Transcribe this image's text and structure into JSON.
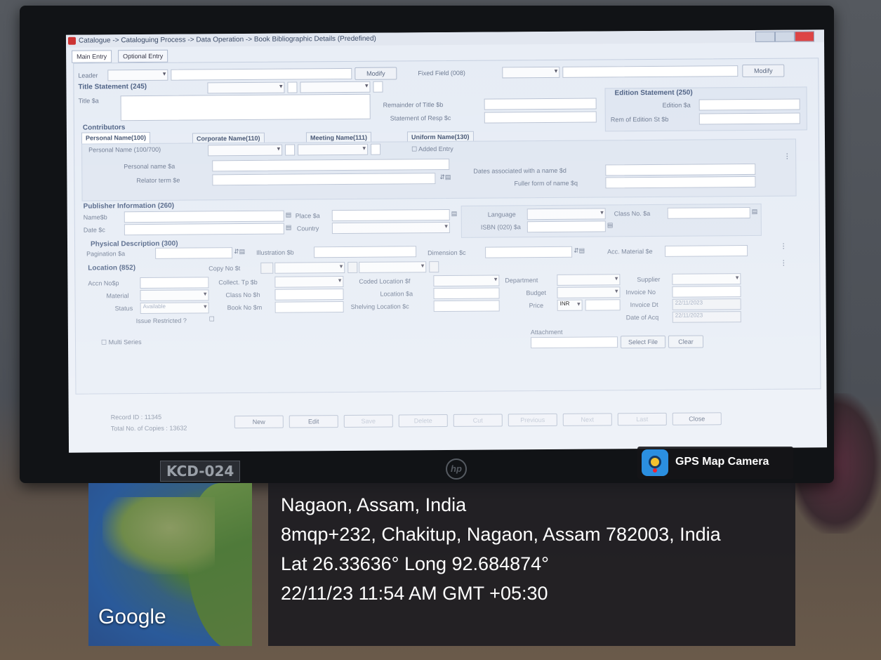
{
  "window": {
    "breadcrumb": "Catalogue -> Cataloguing Process -> Data Operation -> Book Bibliographic Details (Predefined)",
    "tabs": [
      "Main Entry",
      "Optional Entry"
    ]
  },
  "form": {
    "leader_label": "Leader",
    "modify_label": "Modify",
    "fixed_field_label": "Fixed Field (008)",
    "title_statement": "Title Statement (245)",
    "title_sa": "Title $a",
    "remainder_of_title": "Remainder of Title $b",
    "statement_of_resp": "Statement of Resp $c",
    "edition_statement": "Edition Statement (250)",
    "edition_sa": "Edition $a",
    "rem_of_edition": "Rem of Edition St $b",
    "contributors": "Contributors",
    "contributor_tabs": [
      "Personal Name(100)",
      "Corporate Name(110)",
      "Meeting Name(111)",
      "Uniform Name(130)"
    ],
    "personal_name_700": "Personal Name (100/700)",
    "added_entry": "Added Entry",
    "personal_name_sa": "Personal name $a",
    "relator_term": "Relator term $e",
    "dates_assoc": "Dates associated with a name $d",
    "fuller_form": "Fuller form of name $q",
    "publisher_info": "Publisher Information (260)",
    "name_sb": "Name$b",
    "date_sc": "Date $c",
    "place_sa": "Place $a",
    "country": "Country",
    "language": "Language",
    "class_no_sa": "Class No. $a",
    "isbn": "ISBN (020) $a",
    "physical_desc": "Physical Description (300)",
    "pagination": "Pagination $a",
    "illustration": "Illustration $b",
    "dimension": "Dimension $c",
    "acc_material": "Acc. Material $e",
    "location": "Location (852)",
    "copy_no": "Copy No $t",
    "accn_no": "Accn No$p",
    "collect_tp": "Collect. Tp $b",
    "coded_location": "Coded Location $f",
    "department": "Department",
    "supplier": "Supplier",
    "material": "Material",
    "class_no_sh": "Class No $h",
    "location_sa": "Location $a",
    "budget": "Budget",
    "invoice_no": "Invoice No",
    "status_label": "Status",
    "status_value": "Available",
    "book_no": "Book No $m",
    "shelving_location": "Shelving Location $c",
    "price": "Price",
    "price_currency": "INR",
    "invoice_dt": "Invoice Dt",
    "invoice_dt_value": "22/11/2023",
    "date_of_acq": "Date of Acq",
    "date_of_acq_value": "22/11/2023",
    "issue_restricted": "Issue Restricted ?",
    "multi_series": "Multi Series",
    "attachment": "Attachment",
    "select_file": "Select File",
    "clear": "Clear"
  },
  "footer": {
    "record_id": "Record ID :   11345",
    "total_copies": "Total No. of Copies : 13632",
    "buttons": [
      "New",
      "Edit",
      "Save",
      "Delete",
      "Cut",
      "Previous",
      "Next",
      "Last",
      "Close"
    ]
  },
  "monitor": {
    "model_label": "KCD-024",
    "brand": "hp"
  },
  "gps": {
    "app_name": "GPS Map Camera",
    "map_label": "Google",
    "place": "Nagaon, Assam, India",
    "address": "8mqp+232, Chakitup, Nagaon, Assam 782003, India",
    "coords": "Lat 26.33636° Long 92.684874°",
    "datetime": "22/11/23 11:54 AM GMT +05:30"
  }
}
